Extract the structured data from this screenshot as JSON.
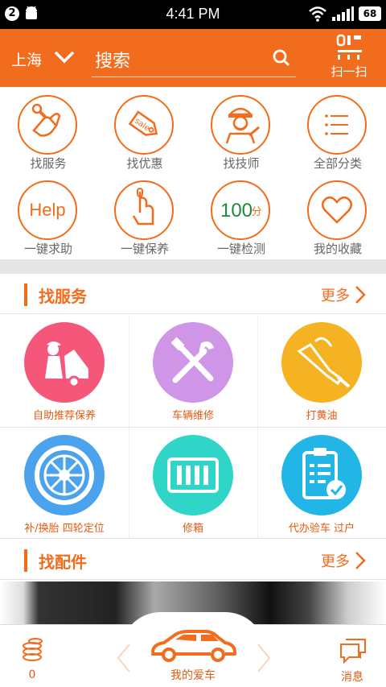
{
  "status_bar": {
    "badge": "2",
    "time": "4:41 PM",
    "battery": "68"
  },
  "header": {
    "city": "上海",
    "search_placeholder": "搜索",
    "scan_label": "扫一扫"
  },
  "quick_items": [
    {
      "label": "找服务",
      "icon": "hand-wrench-icon"
    },
    {
      "label": "找优惠",
      "icon": "sale-tag-icon",
      "icon_text": "sale"
    },
    {
      "label": "找技师",
      "icon": "mechanic-icon"
    },
    {
      "label": "全部分类",
      "icon": "list-icon"
    },
    {
      "label": "一键求助",
      "icon": "help-icon",
      "icon_text": "Help"
    },
    {
      "label": "一键保养",
      "icon": "tap-hand-icon"
    },
    {
      "label": "一键检测",
      "icon": "score-icon",
      "icon_text": "100",
      "icon_unit": "分"
    },
    {
      "label": "我的收藏",
      "icon": "heart-icon"
    }
  ],
  "service_section": {
    "title": "找服务",
    "more": "更多"
  },
  "services": [
    {
      "label": "自助推荐保养",
      "color": "#f5577a",
      "icon": "car-repair-icon"
    },
    {
      "label": "车辆维修",
      "color": "#cf95e6",
      "icon": "tools-icon"
    },
    {
      "label": "打黄油",
      "color": "#f5b323",
      "icon": "grease-gun-icon"
    },
    {
      "label": "补/换胎 四轮定位",
      "color": "#4aa3ec",
      "icon": "wheel-icon"
    },
    {
      "label": "修箱",
      "color": "#2fd6c8",
      "icon": "radiator-icon"
    },
    {
      "label": "代办验车 过户",
      "color": "#22b6e6",
      "icon": "clipboard-check-icon"
    }
  ],
  "parts_section": {
    "title": "找配件",
    "more": "更多"
  },
  "bottom_bar": {
    "coins_count": "0",
    "mycar_label": "我的爱车",
    "message_label": "消息"
  },
  "colors": {
    "accent": "#f26c1e",
    "label": "#e85a12"
  }
}
